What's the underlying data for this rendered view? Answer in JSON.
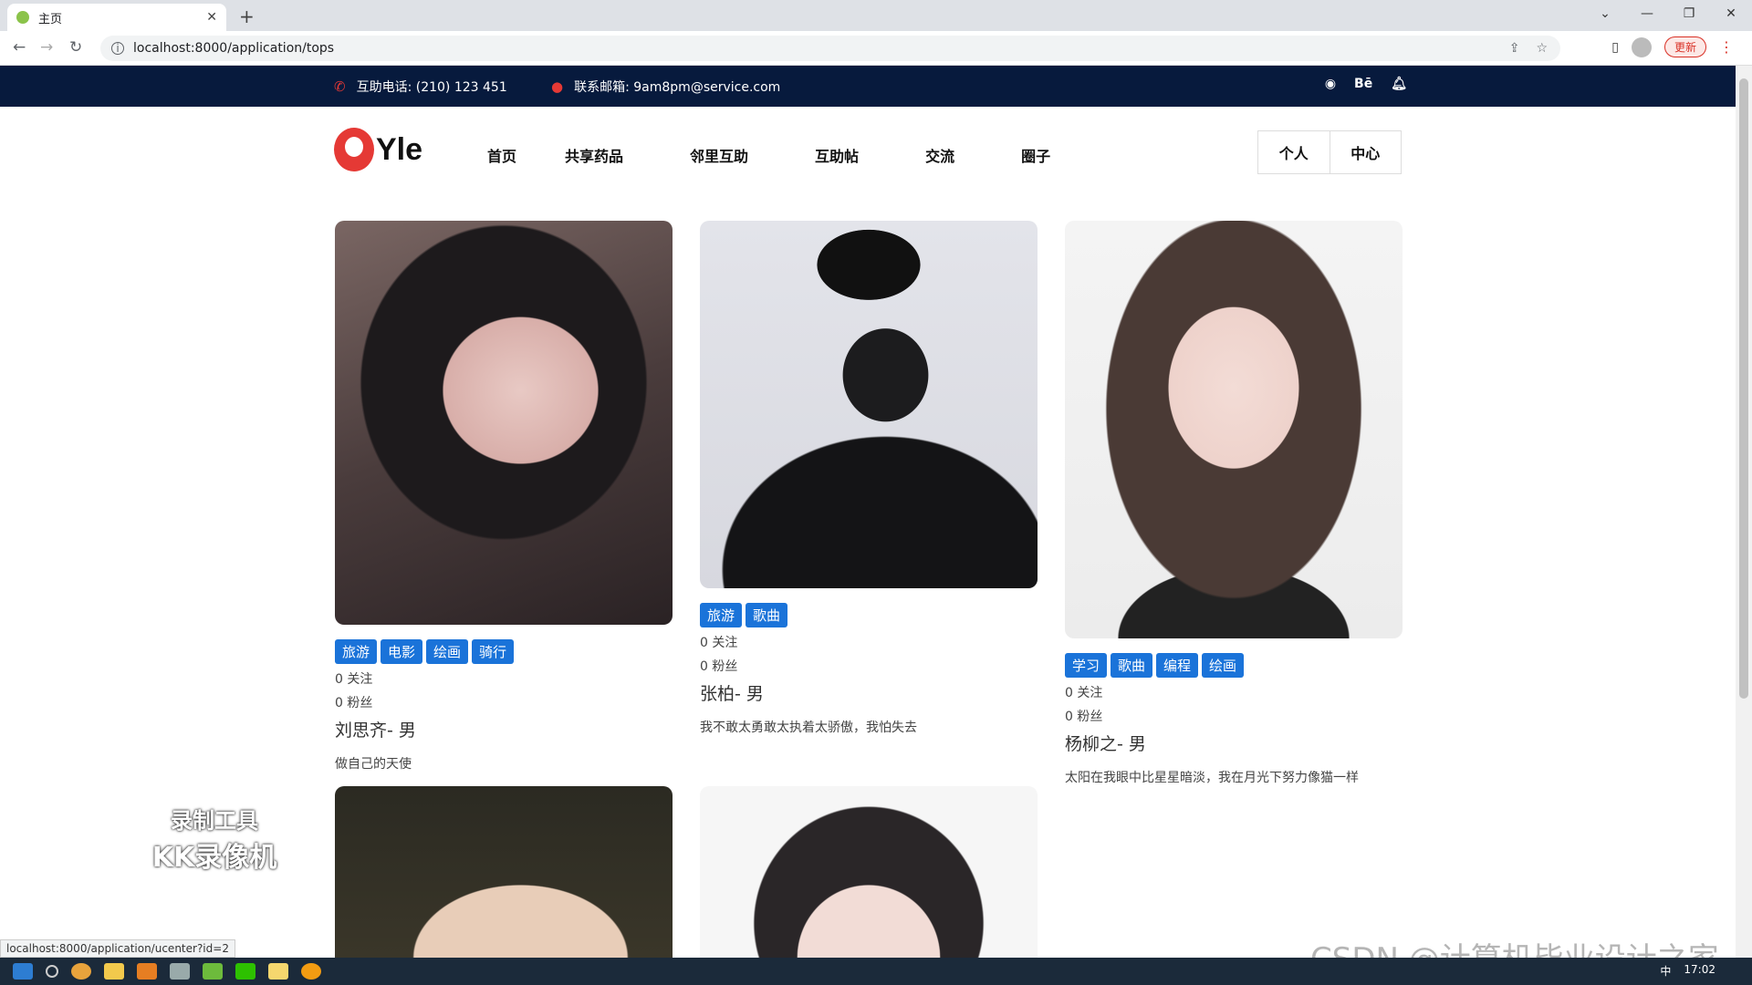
{
  "browser": {
    "tab_title": "主页",
    "url": "localhost:8000/application/tops",
    "update_label": "更新",
    "status_url": "localhost:8000/application/ucenter?id=2"
  },
  "topbar": {
    "phone": "互助电话: (210) 123 451",
    "email": "联系邮箱: 9am8pm@service.com",
    "behance": "Bē"
  },
  "logo": {
    "text": "Yle"
  },
  "menu": [
    "首页",
    "共享药品",
    "邻里互助",
    "互助帖",
    "交流",
    "圈子"
  ],
  "user_center": {
    "left": "个人",
    "right": "中心"
  },
  "cards": [
    {
      "tags": [
        "旅游",
        "电影",
        "绘画",
        "骑行"
      ],
      "follow": "0 关注",
      "fans": "0 粉丝",
      "name": "刘思齐- 男",
      "bio": "做自己的天使"
    },
    {
      "tags": [
        "旅游",
        "歌曲"
      ],
      "follow": "0 关注",
      "fans": "0 粉丝",
      "name": "张柏- 男",
      "bio": "我不敢太勇敢太执着太骄傲，我怕失去"
    },
    {
      "tags": [
        "学习",
        "歌曲",
        "编程",
        "绘画"
      ],
      "follow": "0 关注",
      "fans": "0 粉丝",
      "name": "杨柳之- 男",
      "bio": "太阳在我眼中比星星暗淡，我在月光下努力像猫一样"
    }
  ],
  "watermark": {
    "line1": "录制工具",
    "line2": "KK录像机",
    "csdn": "CSDN @计算机毕业设计之家"
  },
  "taskbar": {
    "time": "17:02",
    "ime": "中"
  },
  "colors": {
    "topbar": "#071a3d",
    "tag": "#1a73d9",
    "accent": "#e53935"
  }
}
